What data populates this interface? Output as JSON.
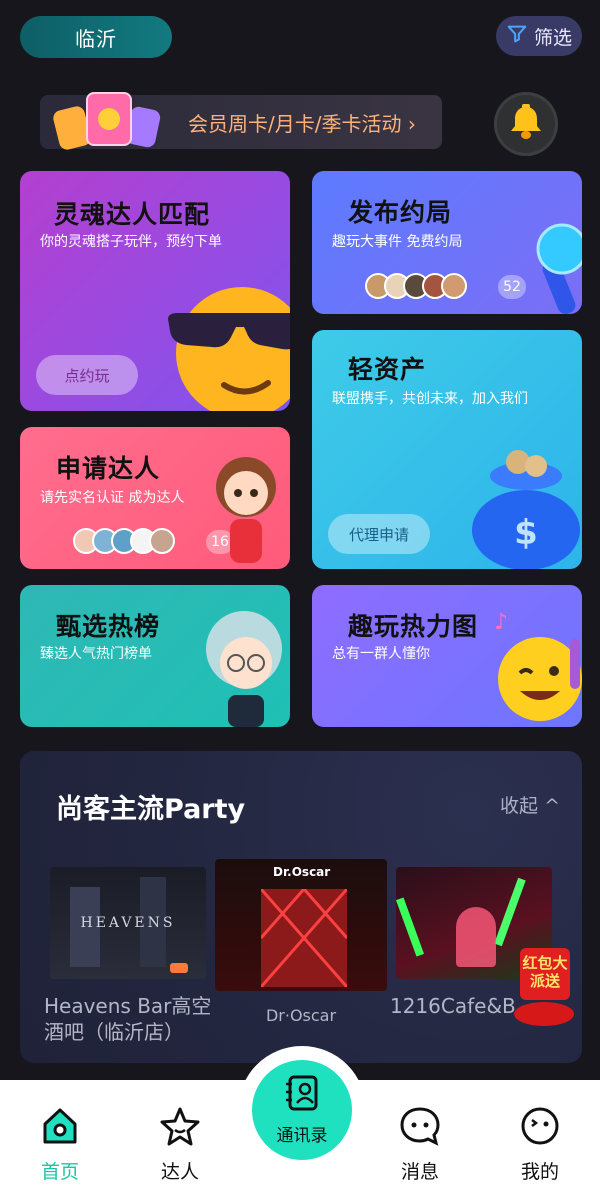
{
  "header": {
    "city": "临沂",
    "filter_label": "筛选"
  },
  "vip_banner": {
    "text": "会员周卡/月卡/季卡活动 ›"
  },
  "cards": {
    "soul": {
      "title": "灵魂达人匹配",
      "subtitle": "你的灵魂搭子玩伴，预约下单",
      "button": "点约玩"
    },
    "post": {
      "title": "发布约局",
      "subtitle": "趣玩大事件 免费约局",
      "count": "52"
    },
    "apply": {
      "title": "申请达人",
      "subtitle": "请先实名认证 成为达人",
      "count": "16"
    },
    "asset": {
      "title": "轻资产",
      "subtitle": "联盟携手，共创未来，加入我们",
      "button": "代理申请"
    },
    "hot": {
      "title": "甄选热榜",
      "subtitle": "臻选人气热门榜单"
    },
    "heat": {
      "title": "趣玩热力图",
      "subtitle": "总有一群人懂你"
    }
  },
  "party": {
    "title": "尚客主流Party",
    "collapse_label": "收起 ^",
    "venues": [
      {
        "name": "Heavens Bar高空酒吧（临沂店）",
        "image_text": "HEAVENS"
      },
      {
        "name": "Dr·Oscar",
        "image_text": "Dr.Oscar"
      },
      {
        "name": "1216Cafe&B",
        "image_text": ""
      }
    ],
    "red_packet": "红包大派送"
  },
  "tabbar": {
    "home": "首页",
    "talent": "达人",
    "contacts": "通讯录",
    "messages": "消息",
    "mine": "我的"
  },
  "colors": {
    "accent": "#1fe1c0",
    "home_active": "#19c7a3",
    "background": "#17161d"
  }
}
